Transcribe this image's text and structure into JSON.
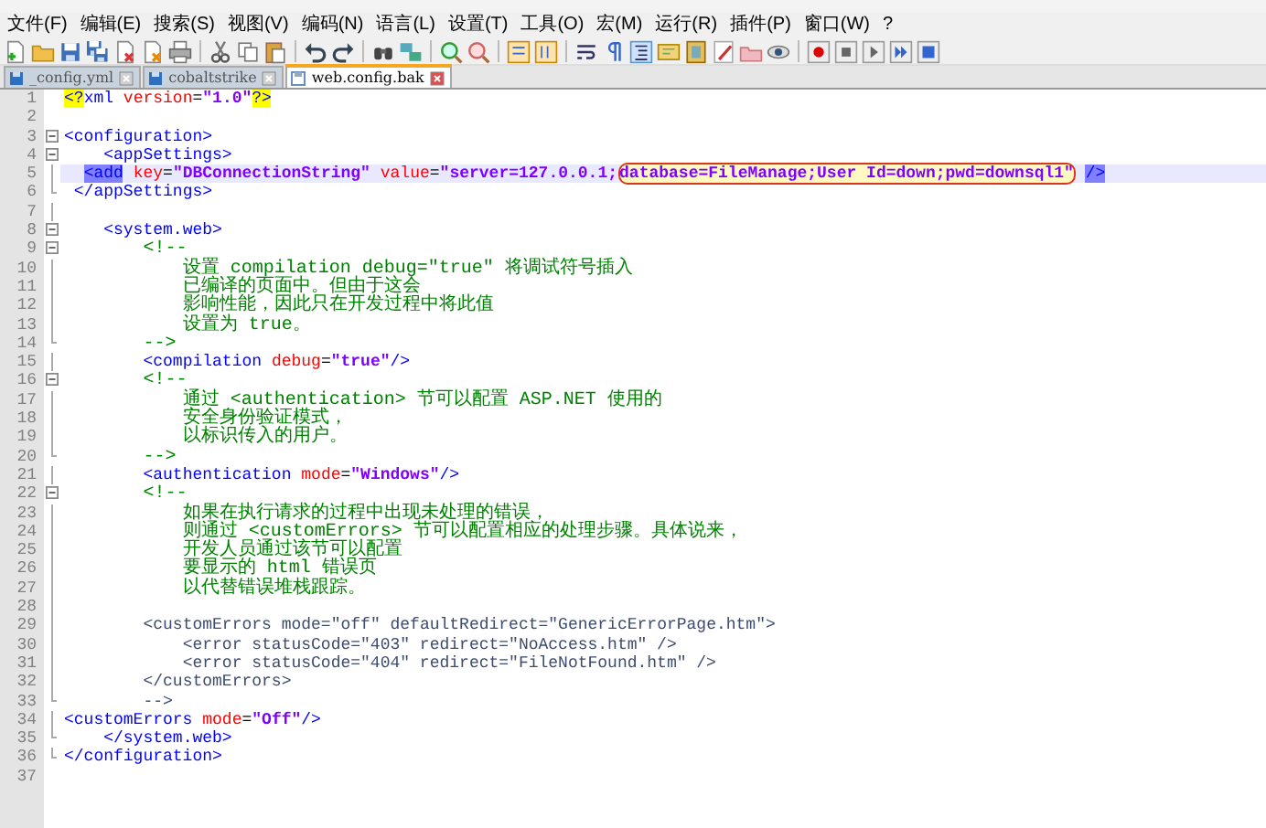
{
  "menu": [
    "文件(F)",
    "编辑(E)",
    "搜索(S)",
    "视图(V)",
    "编码(N)",
    "语言(L)",
    "设置(T)",
    "工具(O)",
    "宏(M)",
    "运行(R)",
    "插件(P)",
    "窗口(W)",
    "?"
  ],
  "tabs": [
    {
      "label": "_config.yml",
      "selected": false
    },
    {
      "label": "cobaltstrike",
      "selected": false
    },
    {
      "label": "web.config.bak",
      "selected": true
    }
  ],
  "lines": [
    {
      "number": "1",
      "kind": "none",
      "current": false,
      "tokens": [
        {
          "kind": "pi",
          "text": "<?"
        },
        {
          "kind": "tag",
          "text": "xml"
        },
        {
          "kind": "attr",
          "text": " version"
        },
        {
          "kind": "plain",
          "text": "="
        },
        {
          "kind": "value",
          "text": "\"1.0\""
        },
        {
          "kind": "pi",
          "text": "?>"
        }
      ]
    },
    {
      "number": "2",
      "kind": "none",
      "current": false
    },
    {
      "number": "3",
      "kind": "open",
      "current": false,
      "tokens": [
        {
          "kind": "tag",
          "text": "<configuration>"
        }
      ]
    },
    {
      "number": "4",
      "kind": "open",
      "current": false,
      "tokens": [
        {
          "kind": "tag",
          "text": "    <appSettings>"
        }
      ]
    },
    {
      "number": "5",
      "kind": "line",
      "current": true,
      "tokens": [
        {
          "kind": "match",
          "text": "  <add"
        },
        {
          "kind": "attr",
          "text": " key"
        },
        {
          "kind": "plain",
          "text": "="
        },
        {
          "kind": "value",
          "text": "\"DBConnectionString\""
        },
        {
          "kind": "attr",
          "text": " value"
        },
        {
          "kind": "plain",
          "text": "="
        },
        {
          "kind": "value",
          "text": "\"server=127.0.0.1;"
        },
        {
          "kind": "boxed",
          "text": "database=FileManage;User Id=down;pwd=downsql1\""
        },
        {
          "kind": "match",
          "text": " />"
        }
      ]
    },
    {
      "number": "6",
      "kind": "end",
      "current": false,
      "tokens": [
        {
          "kind": "tag",
          "text": " </appSettings>"
        }
      ]
    },
    {
      "number": "7",
      "kind": "line",
      "current": false
    },
    {
      "number": "8",
      "kind": "open",
      "current": false,
      "tokens": [
        {
          "kind": "tag",
          "text": "    <system.web>"
        }
      ]
    },
    {
      "number": "9",
      "kind": "open",
      "current": false,
      "tokens": [
        {
          "kind": "comment",
          "text": "        <!--"
        }
      ]
    },
    {
      "number": "10",
      "kind": "line",
      "current": false,
      "tokens": [
        {
          "kind": "comment",
          "text": "            设置 compilation debug=\"true\" 将调试符号插入"
        }
      ]
    },
    {
      "number": "11",
      "kind": "line",
      "current": false,
      "tokens": [
        {
          "kind": "comment",
          "text": "            已编译的页面中。但由于这会"
        }
      ]
    },
    {
      "number": "12",
      "kind": "line",
      "current": false,
      "tokens": [
        {
          "kind": "comment",
          "text": "            影响性能，因此只在开发过程中将此值"
        }
      ]
    },
    {
      "number": "13",
      "kind": "line",
      "current": false,
      "tokens": [
        {
          "kind": "comment",
          "text": "            设置为 true。"
        }
      ]
    },
    {
      "number": "14",
      "kind": "end",
      "current": false,
      "tokens": [
        {
          "kind": "comment",
          "text": "        -->"
        }
      ]
    },
    {
      "number": "15",
      "kind": "line",
      "current": false,
      "tokens": [
        {
          "kind": "tag",
          "text": "        <compilation"
        },
        {
          "kind": "attr",
          "text": " debug"
        },
        {
          "kind": "plain",
          "text": "="
        },
        {
          "kind": "value",
          "text": "\"true\""
        },
        {
          "kind": "tag",
          "text": "/>"
        }
      ]
    },
    {
      "number": "16",
      "kind": "open",
      "current": false,
      "tokens": [
        {
          "kind": "comment",
          "text": "        <!--"
        }
      ]
    },
    {
      "number": "17",
      "kind": "line",
      "current": false,
      "tokens": [
        {
          "kind": "comment",
          "text": "            通过 <authentication> 节可以配置 ASP.NET 使用的"
        }
      ]
    },
    {
      "number": "18",
      "kind": "line",
      "current": false,
      "tokens": [
        {
          "kind": "comment",
          "text": "            安全身份验证模式，"
        }
      ]
    },
    {
      "number": "19",
      "kind": "line",
      "current": false,
      "tokens": [
        {
          "kind": "comment",
          "text": "            以标识传入的用户。"
        }
      ]
    },
    {
      "number": "20",
      "kind": "end",
      "current": false,
      "tokens": [
        {
          "kind": "comment",
          "text": "        -->"
        }
      ]
    },
    {
      "number": "21",
      "kind": "line",
      "current": false,
      "tokens": [
        {
          "kind": "tag",
          "text": "        <authentication"
        },
        {
          "kind": "attr",
          "text": " mode"
        },
        {
          "kind": "plain",
          "text": "="
        },
        {
          "kind": "value",
          "text": "\"Windows\""
        },
        {
          "kind": "tag",
          "text": "/>"
        }
      ]
    },
    {
      "number": "22",
      "kind": "open",
      "current": false,
      "tokens": [
        {
          "kind": "comment",
          "text": "        <!--"
        }
      ]
    },
    {
      "number": "23",
      "kind": "line",
      "current": false,
      "tokens": [
        {
          "kind": "comment",
          "text": "            如果在执行请求的过程中出现未处理的错误，"
        }
      ]
    },
    {
      "number": "24",
      "kind": "line",
      "current": false,
      "tokens": [
        {
          "kind": "comment",
          "text": "            则通过 <customErrors> 节可以配置相应的处理步骤。具体说来，"
        }
      ]
    },
    {
      "number": "25",
      "kind": "line",
      "current": false,
      "tokens": [
        {
          "kind": "comment",
          "text": "            开发人员通过该节可以配置"
        }
      ]
    },
    {
      "number": "26",
      "kind": "line",
      "current": false,
      "tokens": [
        {
          "kind": "comment",
          "text": "            要显示的 html 错误页"
        }
      ]
    },
    {
      "number": "27",
      "kind": "line",
      "current": false,
      "tokens": [
        {
          "kind": "comment",
          "text": "            以代替错误堆栈跟踪。"
        }
      ]
    },
    {
      "number": "28",
      "kind": "line",
      "current": false
    },
    {
      "number": "29",
      "kind": "line",
      "current": false,
      "tokens": [
        {
          "kind": "comment-code",
          "text": "        <customErrors mode=\"off\" defaultRedirect=\"GenericErrorPage.htm\">"
        }
      ]
    },
    {
      "number": "30",
      "kind": "line",
      "current": false,
      "tokens": [
        {
          "kind": "comment-code",
          "text": "            <error statusCode=\"403\" redirect=\"NoAccess.htm\" />"
        }
      ]
    },
    {
      "number": "31",
      "kind": "line",
      "current": false,
      "tokens": [
        {
          "kind": "comment-code",
          "text": "            <error statusCode=\"404\" redirect=\"FileNotFound.htm\" />"
        }
      ]
    },
    {
      "number": "32",
      "kind": "line",
      "current": false,
      "tokens": [
        {
          "kind": "comment-code",
          "text": "        </customErrors>"
        }
      ]
    },
    {
      "number": "33",
      "kind": "end",
      "current": false,
      "tokens": [
        {
          "kind": "comment-code",
          "text": "        -->"
        }
      ]
    },
    {
      "number": "34",
      "kind": "line",
      "current": false,
      "tokens": [
        {
          "kind": "tag",
          "text": "<customErrors"
        },
        {
          "kind": "attr",
          "text": " mode"
        },
        {
          "kind": "plain",
          "text": "="
        },
        {
          "kind": "value",
          "text": "\"Off\""
        },
        {
          "kind": "tag",
          "text": "/>"
        }
      ]
    },
    {
      "number": "35",
      "kind": "end",
      "current": false,
      "tokens": [
        {
          "kind": "tag",
          "text": "    </system.web>"
        }
      ]
    },
    {
      "number": "36",
      "kind": "end",
      "current": false,
      "tokens": [
        {
          "kind": "tag",
          "text": "</configuration>"
        }
      ]
    },
    {
      "number": "37",
      "kind": "none",
      "current": false
    }
  ]
}
